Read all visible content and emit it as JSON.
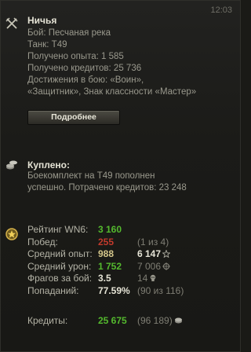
{
  "time": "12:03",
  "battle": {
    "icon": "crossed-swords-icon",
    "title": "Ничья",
    "lines": [
      "Бой: Песчаная река",
      "Танк: T49",
      "Получено опыта: 1 585",
      "Получено кредитов: 25 736",
      "Достижения в бою: «Воин»,",
      "«Защитник», Знак классности «Мастер»"
    ],
    "details_button": "Подробнее"
  },
  "purchase": {
    "icon": "coins-icon",
    "title": "Куплено:",
    "lines": [
      "Боекомплект на T49 пополнен",
      "успешно. Потрачено кредитов:  23 248"
    ]
  },
  "rating": {
    "icon": "rating-medal-icon",
    "colors": {
      "green": "#54b92e",
      "red": "#c23a2c"
    },
    "rows": [
      {
        "label": "Рейтинг WN6:",
        "value": "3 160",
        "extra": ""
      },
      {
        "label": "Побед:",
        "value": "255",
        "extra": "(1 из 4)"
      },
      {
        "label": "Средний опыт:",
        "value": "988",
        "extra": "6 147"
      },
      {
        "label": "Средний урон:",
        "value": "1 752",
        "extra": "7 006"
      },
      {
        "label": "Фрагов за бой:",
        "value": "3.5",
        "extra": "14"
      },
      {
        "label": "Попаданий:",
        "value": "77.59%",
        "extra": "(90 из 116)"
      }
    ],
    "credits": {
      "label": "Кредиты:",
      "value": "25 675",
      "extra": "(96 189)"
    }
  }
}
